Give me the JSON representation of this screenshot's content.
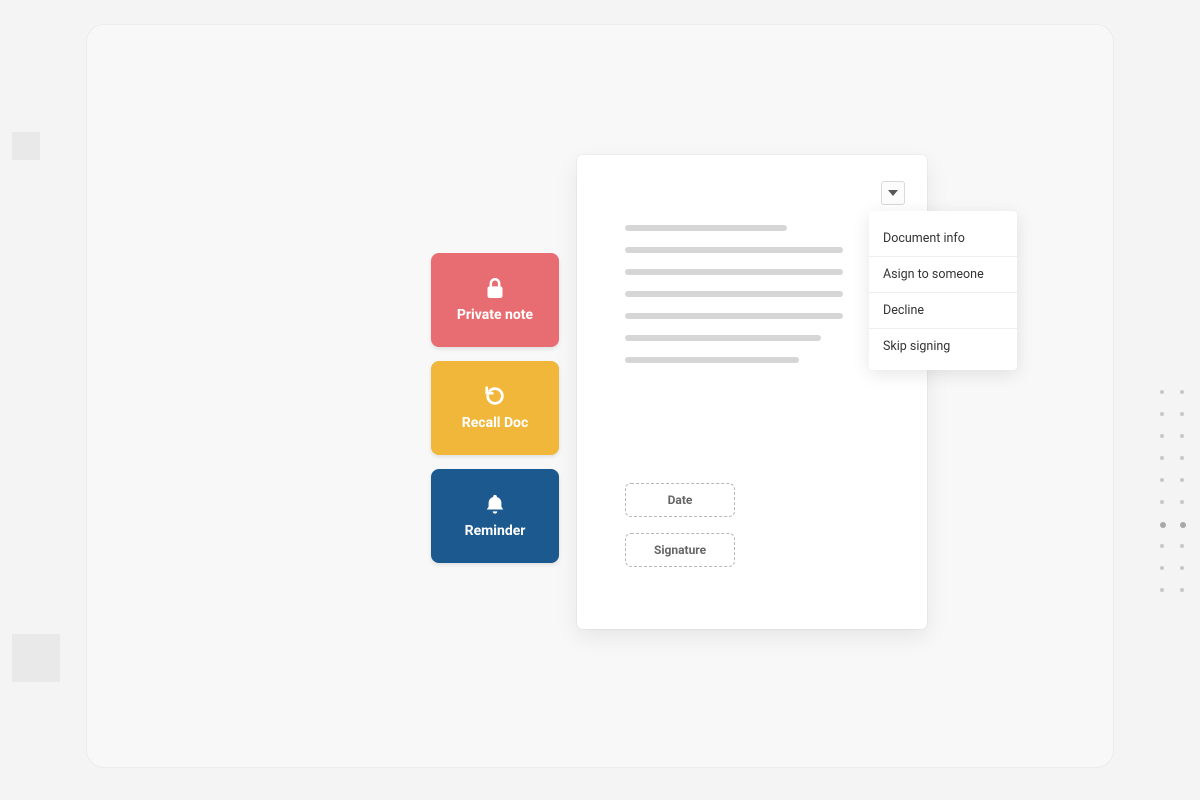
{
  "actions": {
    "private_note": {
      "label": "Private note"
    },
    "recall_doc": {
      "label": "Recall Doc"
    },
    "reminder": {
      "label": "Reminder"
    }
  },
  "fields": {
    "date": {
      "label": "Date"
    },
    "signature": {
      "label": "Signature"
    }
  },
  "dropdown": {
    "items": [
      {
        "label": "Document info"
      },
      {
        "label": "Asign to someone"
      },
      {
        "label": "Decline"
      },
      {
        "label": "Skip signing"
      }
    ]
  },
  "colors": {
    "red": "#e86d72",
    "yellow": "#f0b73b",
    "blue": "#1c598f"
  }
}
